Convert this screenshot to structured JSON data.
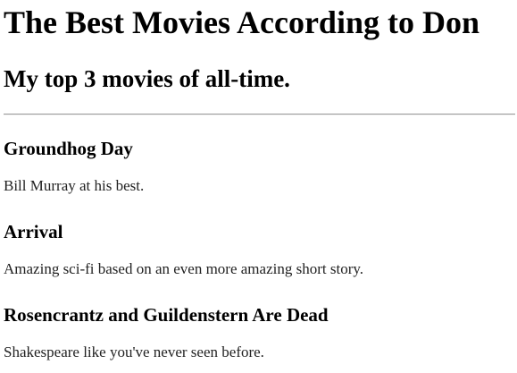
{
  "header": {
    "title": "The Best Movies According to Don",
    "subtitle": "My top 3 movies of all-time."
  },
  "movies": [
    {
      "title": "Groundhog Day",
      "description": "Bill Murray at his best."
    },
    {
      "title": "Arrival",
      "description": "Amazing sci-fi based on an even more amazing short story."
    },
    {
      "title": "Rosencrantz and Guildenstern Are Dead",
      "description": "Shakespeare like you've never seen before."
    }
  ]
}
